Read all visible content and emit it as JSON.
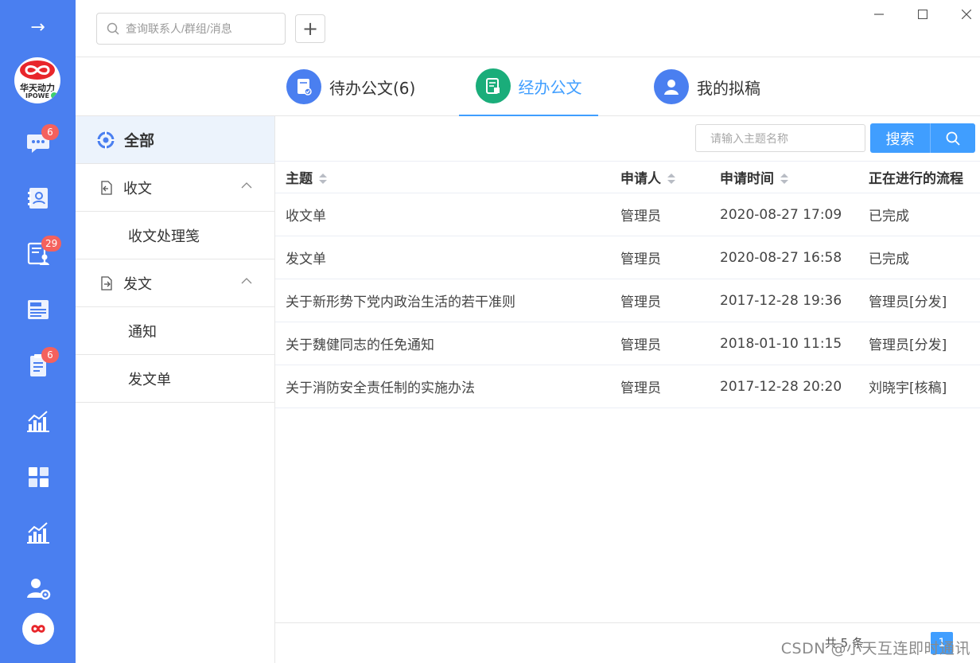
{
  "rail": {
    "expand_glyph": "→",
    "logo": {
      "brand_text": "华天动力",
      "sub_text": "IPOWE"
    },
    "items": [
      {
        "icon": "chat-icon",
        "badge": "6"
      },
      {
        "icon": "contacts-icon",
        "badge": ""
      },
      {
        "icon": "document-user-icon",
        "badge": "29"
      },
      {
        "icon": "news-icon",
        "badge": ""
      },
      {
        "icon": "clipboard-icon",
        "badge": "6"
      },
      {
        "icon": "chart-icon",
        "badge": ""
      },
      {
        "icon": "apps-grid-icon",
        "badge": ""
      },
      {
        "icon": "chart-icon",
        "badge": ""
      },
      {
        "icon": "user-settings-icon",
        "badge": ""
      }
    ]
  },
  "topbar": {
    "search_placeholder": "查询联系人/群组/消息",
    "add_glyph": "+"
  },
  "tabs": [
    {
      "label": "待办公文(6)",
      "color": "#4a7ff0",
      "active": false
    },
    {
      "label": "经办公文",
      "color": "#1aad7a",
      "active": true
    },
    {
      "label": "我的拟稿",
      "color": "#4a7ff0",
      "active": false
    }
  ],
  "categories": {
    "all": "全部",
    "receive": {
      "label": "收文",
      "children": [
        "收文处理笺"
      ]
    },
    "send": {
      "label": "发文",
      "children": [
        "通知",
        "发文单"
      ]
    }
  },
  "filter": {
    "placeholder": "请输入主题名称",
    "search_label": "搜索"
  },
  "table": {
    "headers": [
      "主题",
      "申请人",
      "申请时间",
      "正在进行的流程"
    ],
    "rows": [
      [
        "收文单",
        "管理员",
        "2020-08-27 17:09",
        "已完成"
      ],
      [
        "发文单",
        "管理员",
        "2020-08-27 16:58",
        "已完成"
      ],
      [
        "关于新形势下党内政治生活的若干准则",
        "管理员",
        "2017-12-28 19:36",
        "管理员[分发]"
      ],
      [
        "关于魏健同志的任免通知",
        "管理员",
        "2018-01-10 11:15",
        "管理员[分发]"
      ],
      [
        "关于消防安全责任制的实施办法",
        "管理员",
        "2017-12-28 20:20",
        "刘晓宇[核稿]"
      ]
    ]
  },
  "pager": {
    "total_text": "共 5 条",
    "current_page": "1"
  },
  "watermark": "CSDN @小天互连即时通讯",
  "colors": {
    "rail": "#4a7ff0",
    "accent": "#409eff",
    "badge": "#f4615d",
    "online": "#3ecf6e"
  }
}
